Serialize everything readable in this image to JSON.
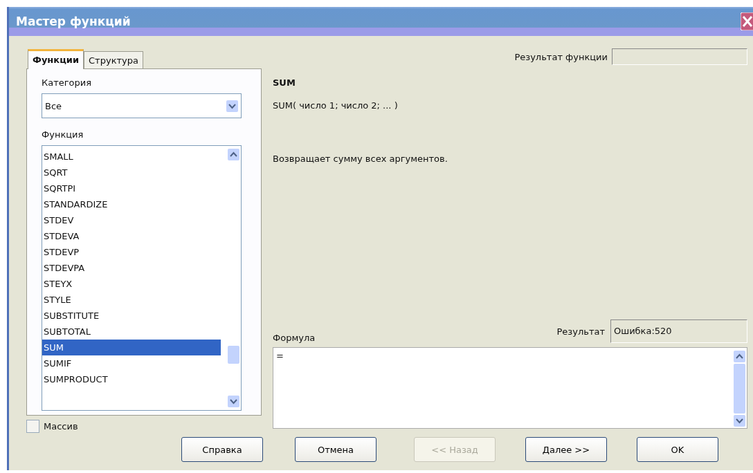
{
  "window": {
    "title": "Мастер функций"
  },
  "tabs": [
    {
      "label": "Функции",
      "selected": true
    },
    {
      "label": "Структура",
      "selected": false
    }
  ],
  "category": {
    "label": "Категория",
    "value": "Все"
  },
  "function_list": {
    "label": "Функция",
    "items": [
      {
        "name": "SMALL",
        "selected": false
      },
      {
        "name": "SQRT",
        "selected": false
      },
      {
        "name": "SQRTPI",
        "selected": false
      },
      {
        "name": "STANDARDIZE",
        "selected": false
      },
      {
        "name": "STDEV",
        "selected": false
      },
      {
        "name": "STDEVA",
        "selected": false
      },
      {
        "name": "STDEVP",
        "selected": false
      },
      {
        "name": "STDEVPA",
        "selected": false
      },
      {
        "name": "STEYX",
        "selected": false
      },
      {
        "name": "STYLE",
        "selected": false
      },
      {
        "name": "SUBSTITUTE",
        "selected": false
      },
      {
        "name": "SUBTOTAL",
        "selected": false
      },
      {
        "name": "SUM",
        "selected": true
      },
      {
        "name": "SUMIF",
        "selected": false
      },
      {
        "name": "SUMPRODUCT",
        "selected": false
      }
    ]
  },
  "function_result": {
    "label": "Результат функции"
  },
  "function_name": "SUM",
  "signature": "SUM( число 1; число 2; ... )",
  "description": "Возвращает сумму всех аргументов.",
  "formula": {
    "label": "Формула",
    "value": "=",
    "result_label": "Результат",
    "result": "Ошибка:520"
  },
  "array": {
    "label": "Массив",
    "checked": false
  },
  "buttons": [
    {
      "label": "Справка",
      "disabled": false
    },
    {
      "label": "Отмена",
      "disabled": false
    },
    {
      "label": "<< Назад",
      "disabled": true
    },
    {
      "label": "Далее >>",
      "disabled": false
    },
    {
      "label": "OK",
      "disabled": false
    }
  ]
}
